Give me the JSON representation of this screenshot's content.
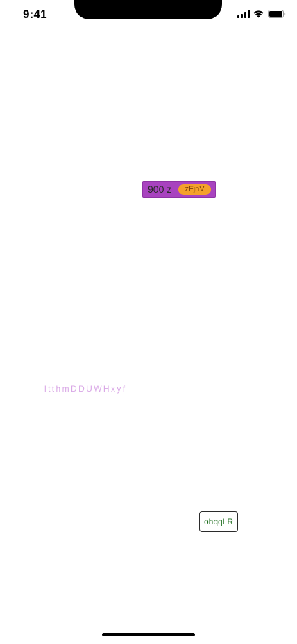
{
  "status_bar": {
    "time": "9:41",
    "icons": [
      "cellular-signal-icon",
      "wifi-icon",
      "battery-icon"
    ]
  },
  "badge": {
    "text": "900 z",
    "pill_text": "zFjnV",
    "colors": {
      "background": "#a843bf",
      "pill": "#f4a12a"
    }
  },
  "faint_text": {
    "text": "ltthmDDUWHxyf",
    "color": "#d9a7e6"
  },
  "button": {
    "label": "ohqqLR",
    "color": "#1c6d1c"
  }
}
